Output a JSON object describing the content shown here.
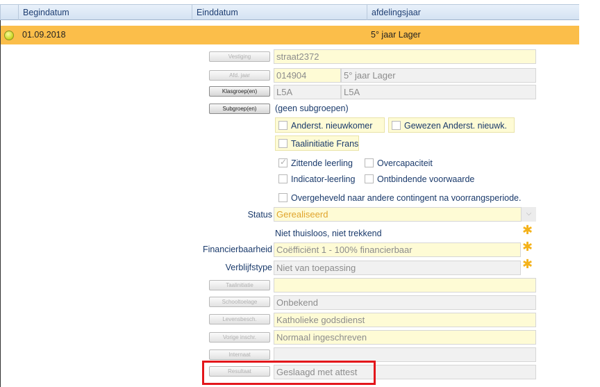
{
  "grid": {
    "columns": [
      "Begindatum",
      "Einddatum",
      "afdelingsjaar"
    ],
    "row": {
      "begindatum": "01.09.2018",
      "einddatum": "",
      "afdelingsjaar": "5° jaar Lager",
      "status_color": "#c9d41f"
    }
  },
  "form": {
    "vestiging": {
      "button": "Vestiging",
      "value": "straat2372"
    },
    "afd_jaar": {
      "button": "Afd. jaar",
      "code": "014904",
      "value": "5° jaar Lager"
    },
    "klasgroep": {
      "button": "Klasgroep(en)",
      "code": "L5A",
      "value": "L5A"
    },
    "subgroep": {
      "button": "Subgroep(en)",
      "value": "(geen subgroepen)"
    },
    "checkboxes": {
      "anderst_nieuwkomer": "Anderst. nieuwkomer",
      "gewezen_anderst": "Gewezen Anderst. nieuwk.",
      "taalinitiatie_frans": "Taalinitiatie Frans",
      "zittende_leerling": "Zittende leerling",
      "overcapaciteit": "Overcapaciteit",
      "indicator_leerling": "Indicator-leerling",
      "ontbindende_voorwaarde": "Ontbindende voorwaarde",
      "overgeheveld": "Overgeheveld naar andere contingent na voorrangsperiode."
    },
    "status": {
      "label": "Status",
      "value": "Gerealiseerd"
    },
    "thuisloos": "Niet thuisloos, niet trekkend",
    "financierbaarheid": {
      "label": "Financierbaarheid",
      "value": "Coëfficiënt 1 - 100% financierbaar"
    },
    "verblijfstype": {
      "label": "Verblijfstype",
      "value": "Niet van toepassing"
    },
    "taalinitiatie": {
      "button": "Taalinitiatie",
      "value": ""
    },
    "schooltoelage": {
      "button": "Schooltoelage",
      "value": "Onbekend"
    },
    "levensbeschouwing": {
      "button": "Levensbesch.",
      "value": "Katholieke godsdienst"
    },
    "vorige_inschr": {
      "button": "Vorige inschr.",
      "value": "Normaal ingeschreven"
    },
    "internaat": {
      "button": "Internaat",
      "value": ""
    },
    "resultaat": {
      "button": "Resultaat",
      "value": "Geslaagd met attest"
    }
  },
  "colors": {
    "row_highlight": "#fbbe4a",
    "annotation_box": "#e3161b",
    "asterisk": "#f4b21a"
  },
  "icons": [
    "status-dot-icon",
    "asterisk-icon",
    "chevron-down-icon",
    "checkmark-icon"
  ]
}
